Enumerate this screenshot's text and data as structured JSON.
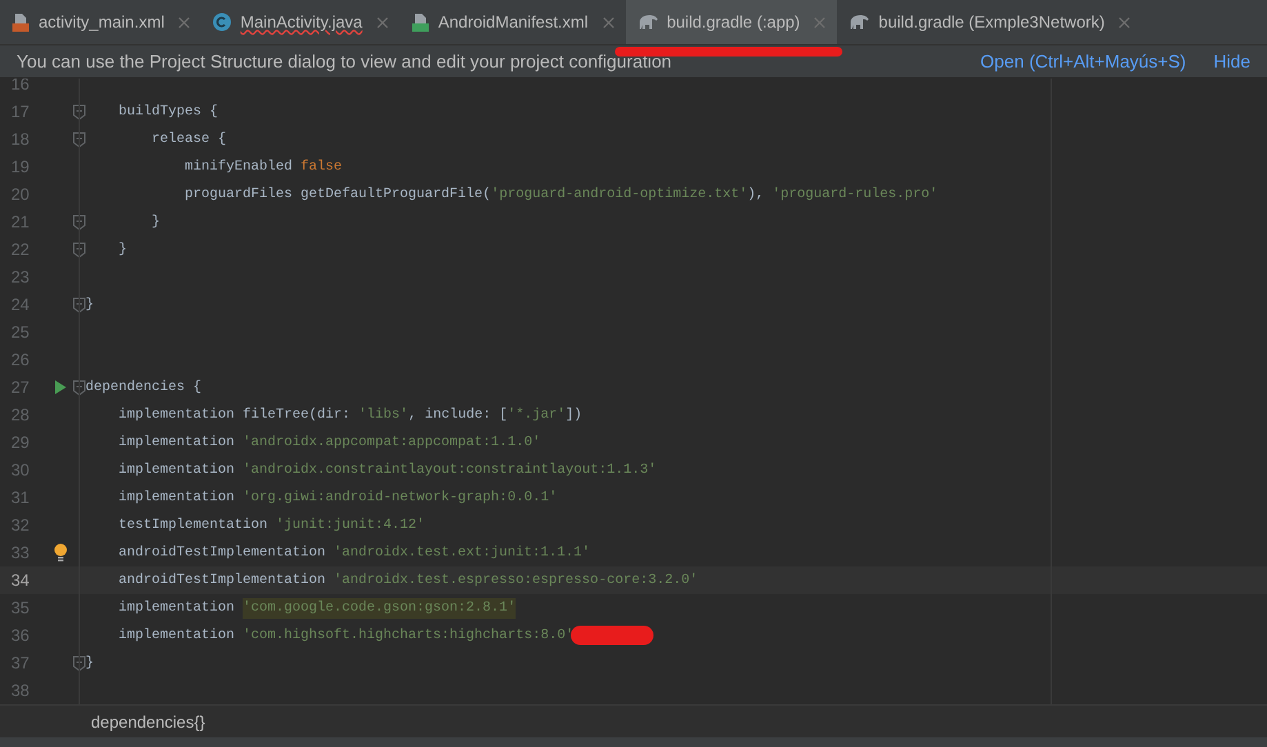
{
  "tabs": [
    {
      "label": "activity_main.xml",
      "kind": "xml",
      "selected": false,
      "error": false,
      "redacted": false
    },
    {
      "label": "MainActivity.java",
      "kind": "java",
      "selected": false,
      "error": true,
      "redacted": false
    },
    {
      "label": "AndroidManifest.xml",
      "kind": "manifest",
      "selected": false,
      "error": false,
      "redacted": false
    },
    {
      "label": "build.gradle (:app)",
      "kind": "gradle",
      "selected": true,
      "error": false,
      "redacted": true
    },
    {
      "label": "build.gradle (Exmple3Network)",
      "kind": "gradle",
      "selected": false,
      "error": false,
      "redacted": false
    }
  ],
  "banner": {
    "message": "You can use the Project Structure dialog to view and edit your project configuration",
    "links": [
      "Open (Ctrl+Alt+Mayús+S)",
      "Hide"
    ]
  },
  "editor": {
    "lines": [
      {
        "number": "16"
      },
      {
        "number": "17",
        "fold": true,
        "tokens": [
          {
            "kind": "plain",
            "text": "    buildTypes {"
          }
        ]
      },
      {
        "number": "18",
        "fold": true,
        "tokens": [
          {
            "kind": "plain",
            "text": "        release {"
          }
        ]
      },
      {
        "number": "19",
        "tokens": [
          {
            "kind": "plain",
            "text": "            minifyEnabled "
          },
          {
            "kind": "keyword",
            "text": "false"
          }
        ]
      },
      {
        "number": "20",
        "tokens": [
          {
            "kind": "plain",
            "text": "            proguardFiles getDefaultProguardFile("
          },
          {
            "kind": "string",
            "text": "'proguard-android-optimize.txt'"
          },
          {
            "kind": "plain",
            "text": "), "
          },
          {
            "kind": "string",
            "text": "'proguard-rules.pro'"
          }
        ]
      },
      {
        "number": "21",
        "fold": true,
        "tokens": [
          {
            "kind": "plain",
            "text": "        }"
          }
        ]
      },
      {
        "number": "22",
        "fold": true,
        "tokens": [
          {
            "kind": "plain",
            "text": "    }"
          }
        ]
      },
      {
        "number": "23"
      },
      {
        "number": "24",
        "fold": true,
        "tokens": [
          {
            "kind": "plain",
            "text": "}"
          }
        ]
      },
      {
        "number": "25"
      },
      {
        "number": "26"
      },
      {
        "number": "27",
        "fold": true,
        "run": true,
        "tokens": [
          {
            "kind": "plain",
            "text": "dependencies {"
          }
        ]
      },
      {
        "number": "28",
        "tokens": [
          {
            "kind": "plain",
            "text": "    implementation fileTree("
          },
          {
            "kind": "param",
            "text": "dir: "
          },
          {
            "kind": "string",
            "text": "'libs'"
          },
          {
            "kind": "plain",
            "text": ", "
          },
          {
            "kind": "param",
            "text": "include: "
          },
          {
            "kind": "plain",
            "text": "["
          },
          {
            "kind": "string",
            "text": "'*.jar'"
          },
          {
            "kind": "plain",
            "text": "])"
          }
        ]
      },
      {
        "number": "29",
        "tokens": [
          {
            "kind": "plain",
            "text": "    implementation "
          },
          {
            "kind": "string",
            "text": "'androidx.appcompat:appcompat:1.1.0'"
          }
        ]
      },
      {
        "number": "30",
        "tokens": [
          {
            "kind": "plain",
            "text": "    implementation "
          },
          {
            "kind": "string",
            "text": "'androidx.constraintlayout:constraintlayout:1.1.3'"
          }
        ]
      },
      {
        "number": "31",
        "tokens": [
          {
            "kind": "plain",
            "text": "    implementation "
          },
          {
            "kind": "string",
            "text": "'org.giwi:android-network-graph:0.0.1'"
          }
        ]
      },
      {
        "number": "32",
        "tokens": [
          {
            "kind": "plain",
            "text": "    testImplementation "
          },
          {
            "kind": "string",
            "text": "'junit:junit:4.12'"
          }
        ]
      },
      {
        "number": "33",
        "hint": true,
        "tokens": [
          {
            "kind": "plain",
            "text": "    androidTestImplementation "
          },
          {
            "kind": "string",
            "text": "'androidx.test.ext:junit:1.1.1'"
          }
        ]
      },
      {
        "number": "34",
        "current": true,
        "tokens": [
          {
            "kind": "plain",
            "text": "    androidTestImplementation "
          },
          {
            "kind": "string",
            "text": "'androidx.test.espresso:espresso-core:3.2.0'"
          }
        ]
      },
      {
        "number": "35",
        "tokens": [
          {
            "kind": "plain",
            "text": "    implementation "
          },
          {
            "kind": "highlight",
            "text": "'com.google.code.gson:gson:2.8.1'"
          }
        ]
      },
      {
        "number": "36",
        "redacted": true,
        "tokens": [
          {
            "kind": "plain",
            "text": "    implementation "
          },
          {
            "kind": "string",
            "text": "'com.highsoft.highcharts:highcharts:8.0'"
          }
        ]
      },
      {
        "number": "37",
        "fold": true,
        "tokens": [
          {
            "kind": "plain",
            "text": "}"
          }
        ]
      },
      {
        "number": "38"
      }
    ]
  },
  "breadcrumb": "dependencies{}"
}
